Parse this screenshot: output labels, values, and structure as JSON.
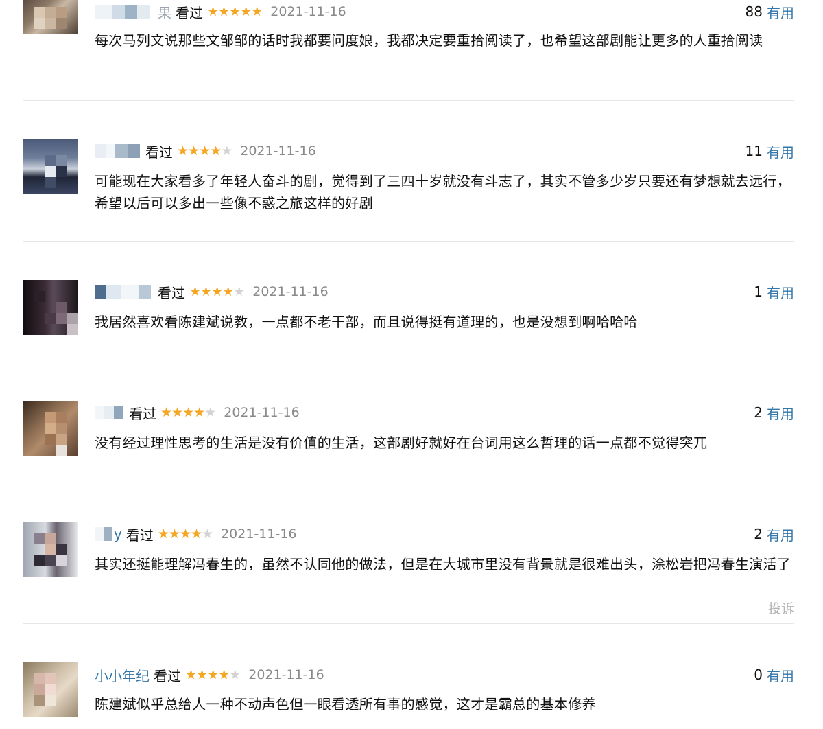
{
  "reviews": [
    {
      "username": "",
      "name_tail": "果",
      "status": "看过",
      "rating": 5,
      "date": "2021-11-16",
      "votes": "88",
      "useful_label": "有用",
      "content": "每次马列文说那些文邹邹的话时我都要问度娘，我都决定要重拾阅读了，也希望这部剧能让更多的人重拾阅读"
    },
    {
      "username": "",
      "status": "看过",
      "rating": 4,
      "date": "2021-11-16",
      "votes": "11",
      "useful_label": "有用",
      "content": "可能现在大家看多了年轻人奋斗的剧，觉得到了三四十岁就没有斗志了，其实不管多少岁只要还有梦想就去远行，希望以后可以多出一些像不惑之旅这样的好剧"
    },
    {
      "username": "",
      "status": "看过",
      "rating": 4,
      "date": "2021-11-16",
      "votes": "1",
      "useful_label": "有用",
      "content": "我居然喜欢看陈建斌说教，一点都不老干部，而且说得挺有道理的，也是没想到啊哈哈哈"
    },
    {
      "username": "",
      "status": "看过",
      "rating": 4,
      "date": "2021-11-16",
      "votes": "2",
      "useful_label": "有用",
      "content": "没有经过理性思考的生活是没有价值的生活，这部剧好就好在台词用这么哲理的话一点都不觉得突兀"
    },
    {
      "username": "",
      "name_tail": "y",
      "status": "看过",
      "rating": 4,
      "date": "2021-11-16",
      "votes": "2",
      "useful_label": "有用",
      "content": "其实还挺能理解冯春生的，虽然不认同他的做法，但是在大城市里没有背景就是很难出头，涂松岩把冯春生演活了",
      "report_label": "投诉"
    },
    {
      "username": "小小年纪",
      "status": "看过",
      "rating": 4,
      "date": "2021-11-16",
      "votes": "0",
      "useful_label": "有用",
      "content": "陈建斌似乎总给人一种不动声色但一眼看透所有事的感觉，这才是霸总的基本修养"
    }
  ]
}
